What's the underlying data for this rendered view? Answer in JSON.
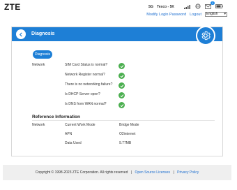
{
  "header": {
    "logo": "ZTE",
    "region": "SG",
    "operator": "Tesco - 5K",
    "mail_count": "1",
    "modify_password": "Modify Login Password",
    "logout": "Logout",
    "language": "English"
  },
  "card": {
    "title": "Diagnosis",
    "diagnosis_button": "Diagnosis",
    "network_label": "Network",
    "checks": [
      {
        "label": "SIM Card Status is normal?"
      },
      {
        "label": "Network Register normal?"
      },
      {
        "label": "There is no networking failure?"
      },
      {
        "label": "Is DHCP Server open?"
      },
      {
        "label": "Is DNS from WAN normal?"
      }
    ],
    "reference": {
      "title": "Reference Information",
      "network_label": "Network",
      "rows": [
        {
          "key": "Current Work Mode",
          "value": "Bridge Mode"
        },
        {
          "key": "APN",
          "value": "O2internet"
        },
        {
          "key": "Data Used",
          "value": "9.77MB"
        }
      ]
    }
  },
  "footer": {
    "copyright": "Copyright © 1998-2023 ZTE Corporation. All rights reserved",
    "sep1": "|",
    "open_source": "Open Source Licenses",
    "sep2": "|",
    "privacy": "Privacy Policy"
  },
  "colors": {
    "accent": "#1e7fd6",
    "ok": "#4caf50",
    "link": "#1e6fd0"
  },
  "icons": [
    "back-arrow-icon",
    "gear-icon",
    "check-icon",
    "signal-icon",
    "globe-icon",
    "mail-icon",
    "battery-icon"
  ]
}
